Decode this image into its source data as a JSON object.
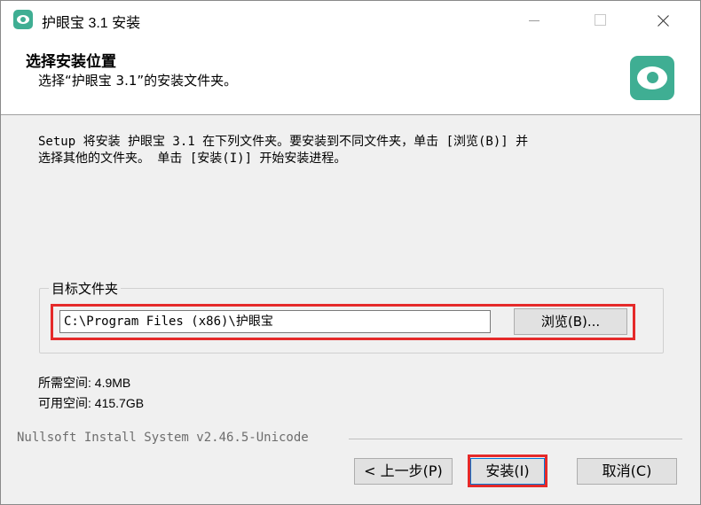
{
  "window": {
    "title": "护眼宝 3.1 安装"
  },
  "header": {
    "title": "选择安装位置",
    "subtitle": "选择“护眼宝 3.1”的安装文件夹。",
    "logo_icon": "eye-logo-icon"
  },
  "body": {
    "description_line1": "Setup 将安装 护眼宝 3.1 在下列文件夹。要安装到不同文件夹，单击 [浏览(B)] 并",
    "description_line2": "选择其他的文件夹。 单击 [安装(I)] 开始安装进程。",
    "destination_group_label": "目标文件夹",
    "destination_path": "C:\\Program Files (x86)\\护眼宝",
    "browse_label": "浏览(B)...",
    "space_required": "所需空间: 4.9MB",
    "space_available": "可用空间: 415.7GB"
  },
  "footer": {
    "branding": "Nullsoft Install System v2.46.5-Unicode",
    "back_label": "< 上一步(P)",
    "install_label": "安装(I)",
    "cancel_label": "取消(C)"
  },
  "colors": {
    "brand": "#3fae93",
    "highlight": "#e52a2a",
    "focus": "#0078d7"
  }
}
